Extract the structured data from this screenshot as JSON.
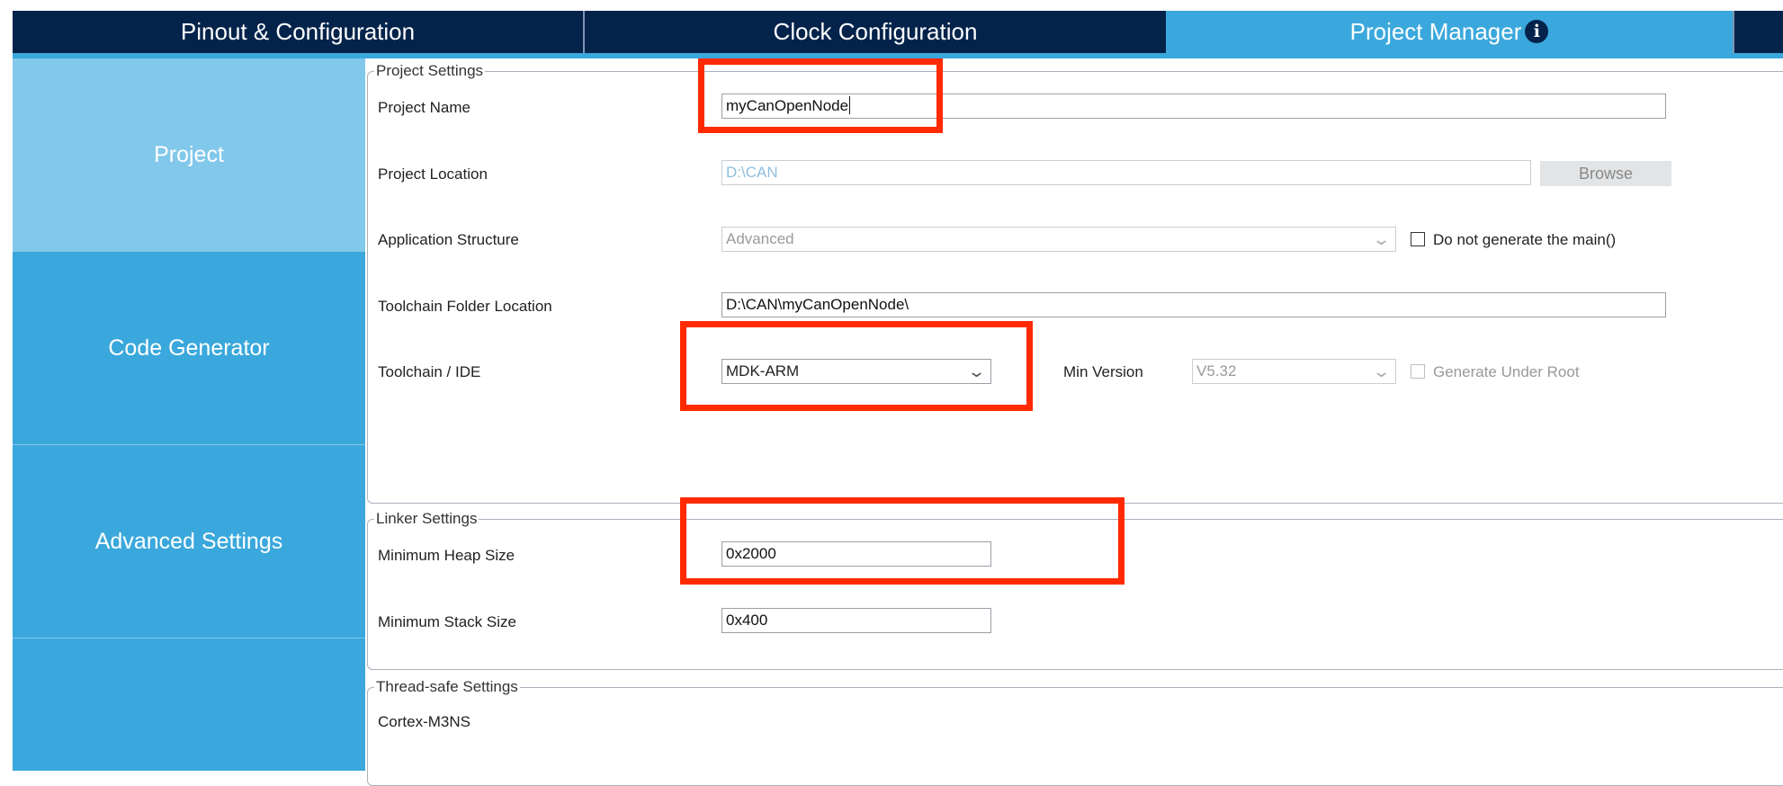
{
  "tabs": [
    {
      "label": "Pinout & Configuration"
    },
    {
      "label": "Clock Configuration"
    },
    {
      "label": "Project Manager"
    }
  ],
  "sidenav": {
    "items": [
      {
        "label": "Project"
      },
      {
        "label": "Code Generator"
      },
      {
        "label": "Advanced Settings"
      }
    ]
  },
  "project_settings": {
    "legend": "Project Settings",
    "project_name_label": "Project Name",
    "project_name_value": "myCanOpenNode",
    "project_location_label": "Project Location",
    "project_location_value": "D:\\CAN",
    "browse_label": "Browse",
    "app_structure_label": "Application Structure",
    "app_structure_value": "Advanced",
    "no_main_label": "Do not generate the main()",
    "toolchain_folder_label": "Toolchain Folder Location",
    "toolchain_folder_value": "D:\\CAN\\myCanOpenNode\\",
    "toolchain_ide_label": "Toolchain / IDE",
    "toolchain_ide_value": "MDK-ARM",
    "min_version_label": "Min Version",
    "min_version_value": "V5.32",
    "generate_under_root_label": "Generate Under Root"
  },
  "linker_settings": {
    "legend": "Linker Settings",
    "heap_label": "Minimum Heap Size",
    "heap_value": "0x2000",
    "stack_label": "Minimum Stack Size",
    "stack_value": "0x400"
  },
  "thread_safe": {
    "legend": "Thread-safe Settings",
    "core_label": "Cortex-M3NS"
  },
  "colors": {
    "navy": "#03234b",
    "accent_blue": "#3aa8dc",
    "active_nav": "#81c8ea",
    "annotation_red": "#ff2a00"
  }
}
